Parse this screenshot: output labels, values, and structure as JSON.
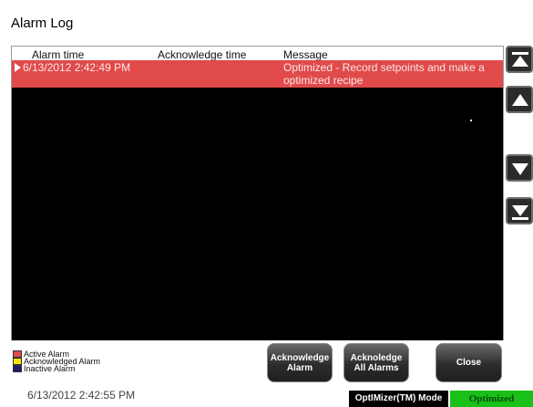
{
  "window": {
    "title": "Alarm Log"
  },
  "table": {
    "columns": [
      "Alarm time",
      "Acknowledge time",
      "Message"
    ],
    "rows": [
      {
        "alarm_time": "6/13/2012 2:42:49 PM",
        "acknowledge_time": "",
        "message": "Optimized - Record setpoints and make a optimized recipe",
        "status": "active"
      }
    ]
  },
  "nav": {
    "top": "scroll-to-top-icon",
    "up": "scroll-up-icon",
    "down": "scroll-down-icon",
    "bottom": "scroll-to-bottom-icon"
  },
  "legend": [
    {
      "label": "Active Alarm",
      "color": "#e04a4a"
    },
    {
      "label": "Acknowledged Alarm",
      "color": "#f5e400"
    },
    {
      "label": "Inactive Alarm",
      "color": "#1c1c6a"
    }
  ],
  "buttons": {
    "ack": "Acknowledge\nAlarm",
    "ack_all": "Acknoledge\nAll Alarms",
    "close": "Close"
  },
  "status": {
    "timestamp": "6/13/2012 2:42:55 PM",
    "mode_label": "OptIMizer(TM) Mode",
    "mode_value": "Optimized"
  },
  "colors": {
    "active": "#e04a4a",
    "mode_ok": "#18c018"
  }
}
